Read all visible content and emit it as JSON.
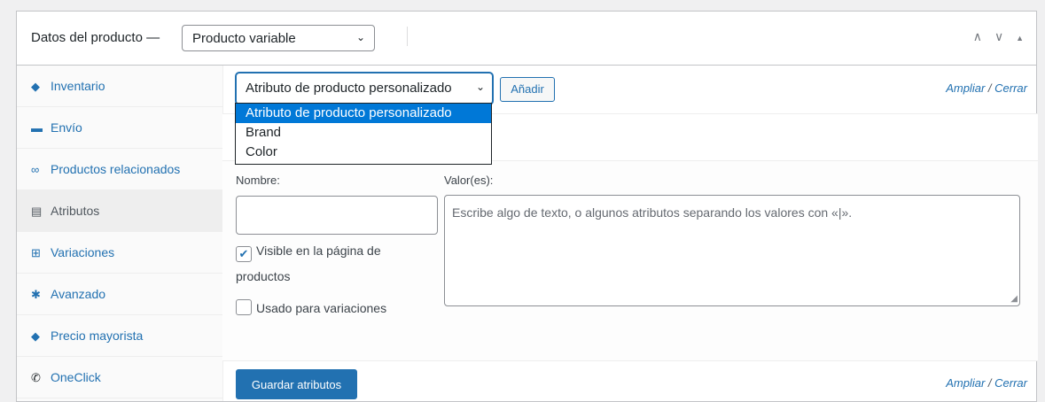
{
  "header": {
    "title": "Datos del producto —",
    "product_type": "Producto variable",
    "controls": [
      "∧",
      "∨",
      "▲"
    ]
  },
  "sidebar": {
    "items": [
      {
        "label": "Inventario",
        "icon": "diamond-tag-icon"
      },
      {
        "label": "Envío",
        "icon": "truck-icon"
      },
      {
        "label": "Productos relacionados",
        "icon": "link-icon"
      },
      {
        "label": "Atributos",
        "icon": "list-icon"
      },
      {
        "label": "Variaciones",
        "icon": "grid-icon"
      },
      {
        "label": "Avanzado",
        "icon": "gear-icon"
      },
      {
        "label": "Precio mayorista",
        "icon": "tag-icon"
      },
      {
        "label": "OneClick",
        "icon": "whatsapp-icon"
      }
    ]
  },
  "attributes": {
    "selected": "Atributo de producto personalizado",
    "add_label": "Añadir",
    "expand": "Ampliar",
    "close": "Cerrar",
    "separator": "/",
    "options": [
      "Atributo de producto personalizado",
      "Brand",
      "Color"
    ],
    "name_label": "Nombre:",
    "values_label": "Valor(es):",
    "values_placeholder": "Escribe algo de texto, o algunos atributos separando los valores con «|».",
    "visible_label_1": "Visible en la página de",
    "visible_label_2": "productos",
    "variations_label": "Usado para variaciones",
    "save_label": "Guardar atributos"
  },
  "colors": {
    "accent": "#2271b1",
    "selection": "#0078d7"
  }
}
